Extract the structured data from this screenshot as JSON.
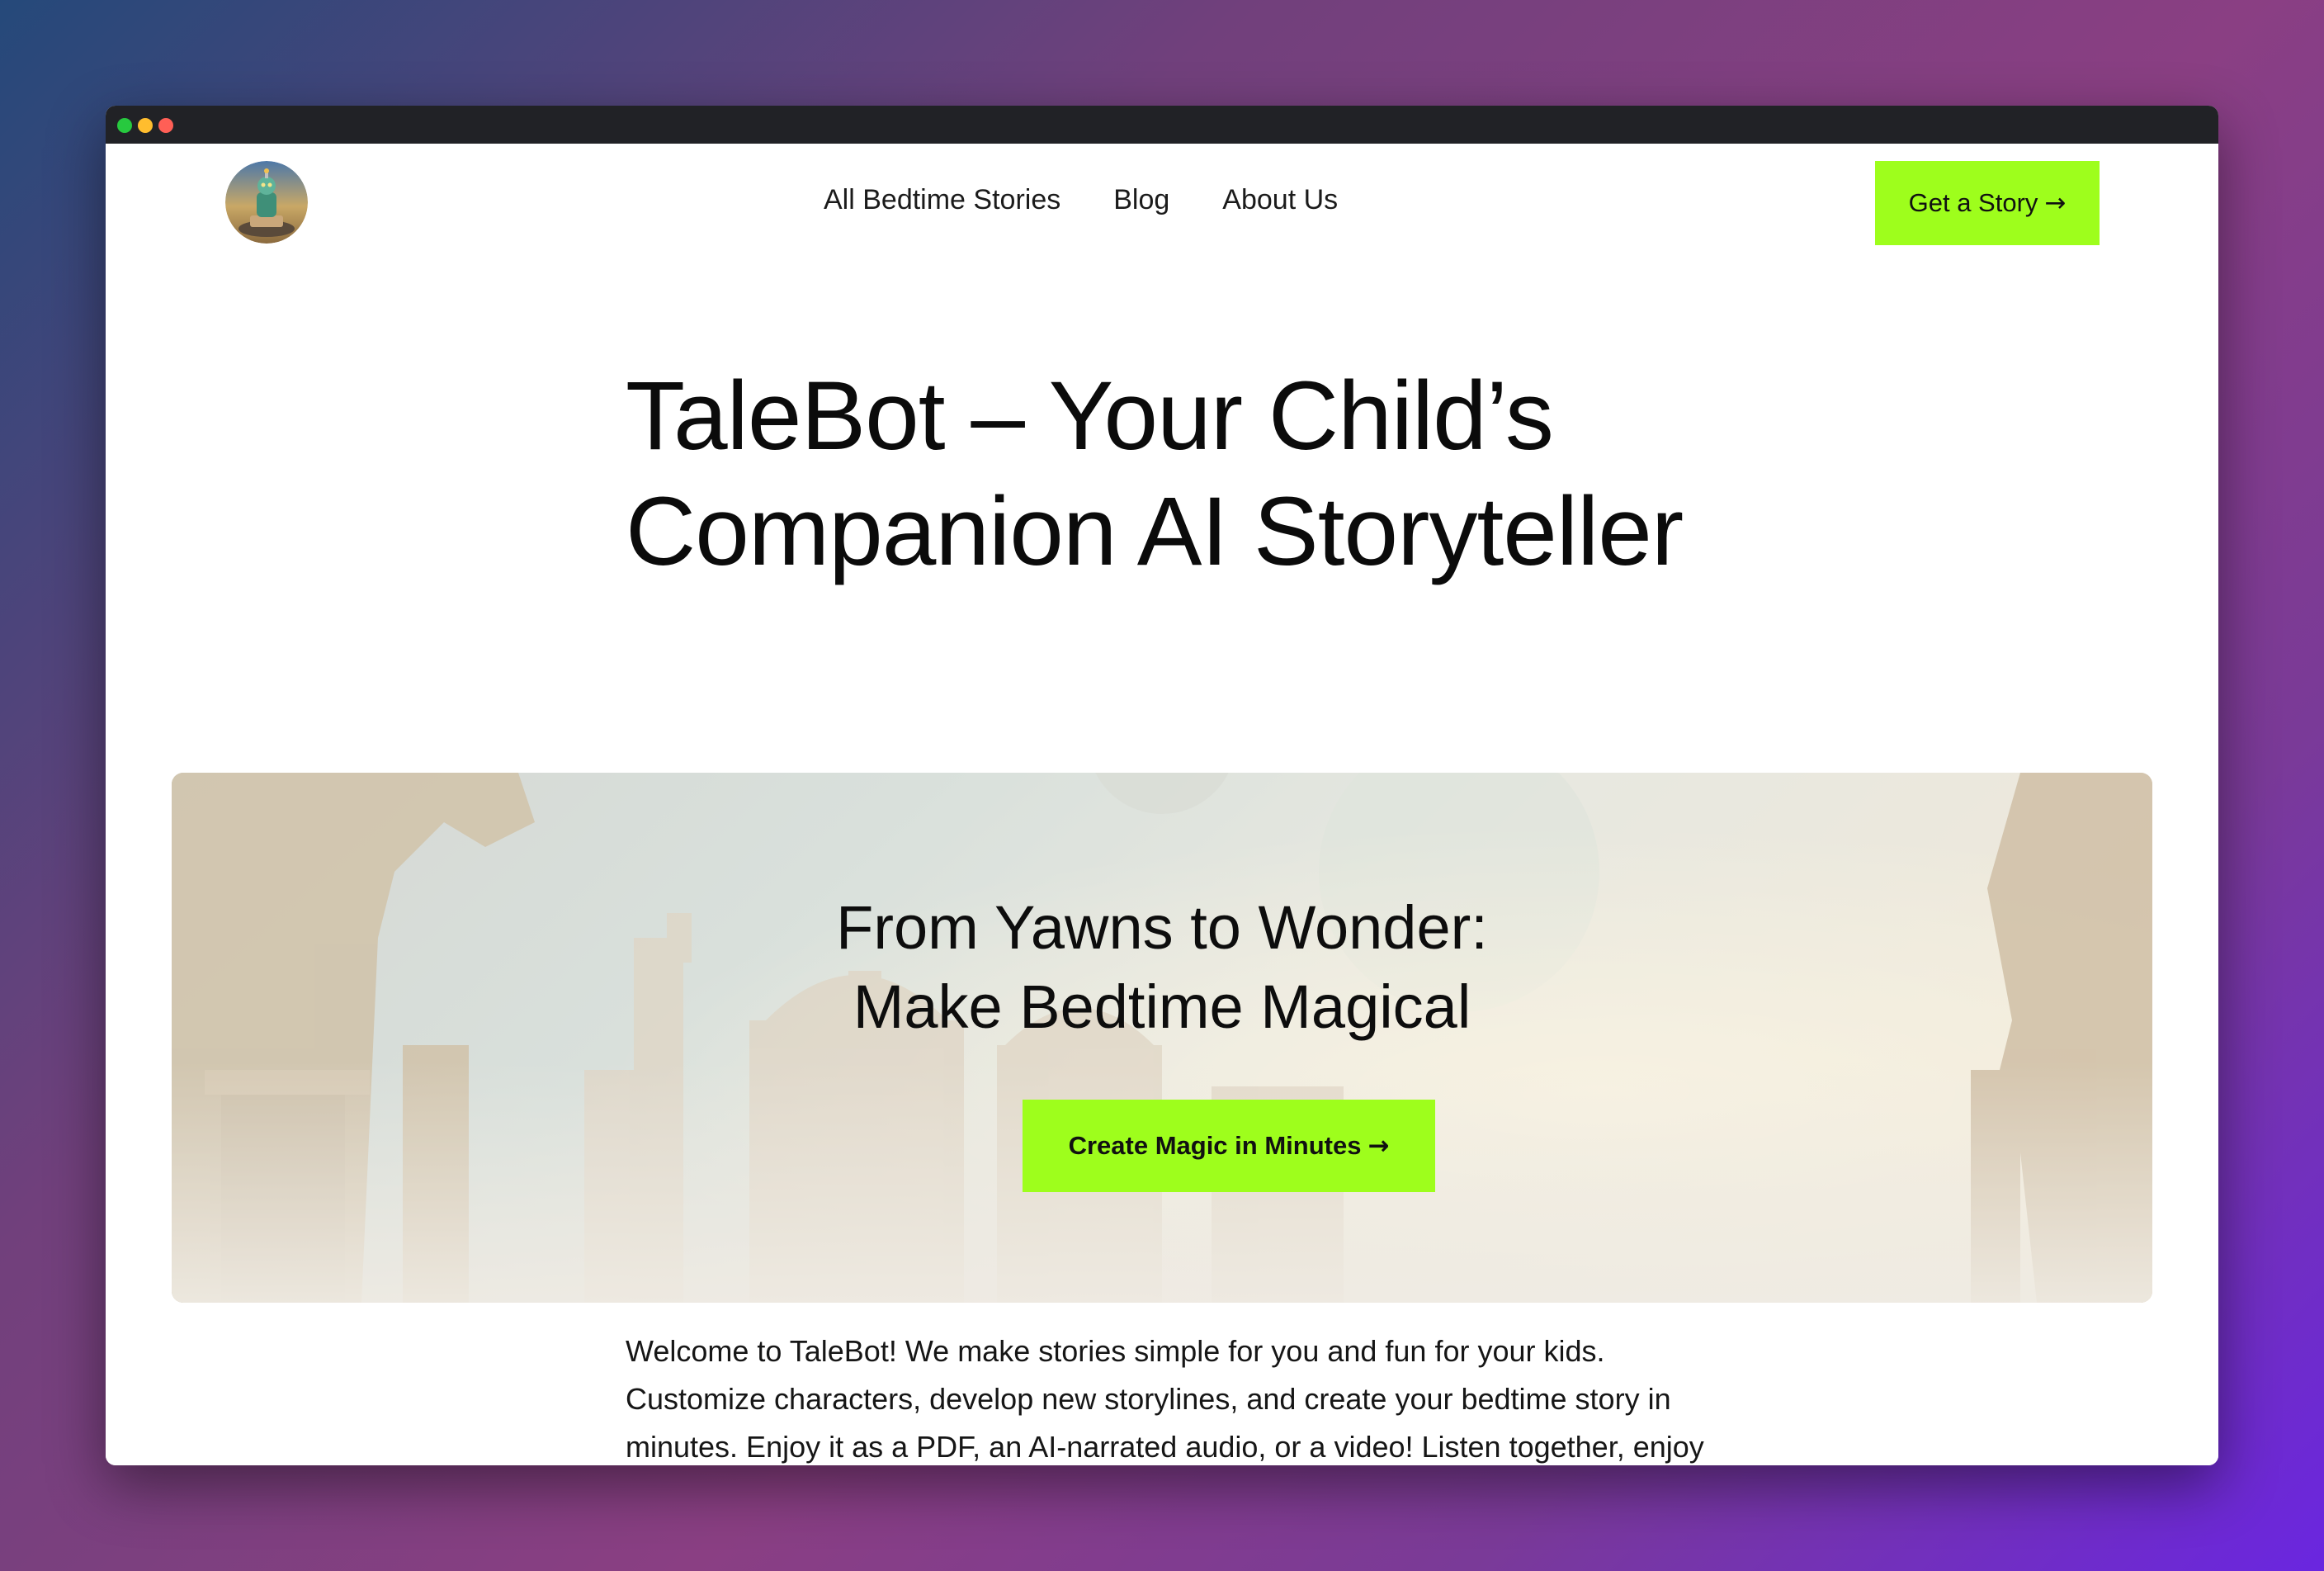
{
  "window": {
    "controls": [
      "green-dot",
      "yellow-dot",
      "red-dot"
    ]
  },
  "header": {
    "logo_icon": "robot-storyteller-avatar",
    "nav": [
      {
        "label": "All Bedtime Stories"
      },
      {
        "label": "Blog"
      },
      {
        "label": "About Us"
      }
    ],
    "cta": {
      "label": "Get a Story",
      "icon": "→"
    }
  },
  "hero": {
    "title_line1": "TaleBot – Your Child’s",
    "title_line2": "Companion AI Storyteller"
  },
  "banner": {
    "heading_line1": "From Yawns to Wonder:",
    "heading_line2": "Make Bedtime Magical",
    "cta": {
      "label": "Create Magic in Minutes",
      "icon": "→"
    }
  },
  "intro": {
    "text": "Welcome to TaleBot! We make stories simple for you and fun for your kids. Customize characters, develop new storylines, and create your bedtime story in minutes. Enjoy it as a PDF, an AI-narrated audio, or a video! Listen together, enjoy the giggles, and make memories."
  },
  "colors": {
    "accent": "#9efe1c",
    "text": "#0b0b0b",
    "titlebar": "#212226"
  }
}
